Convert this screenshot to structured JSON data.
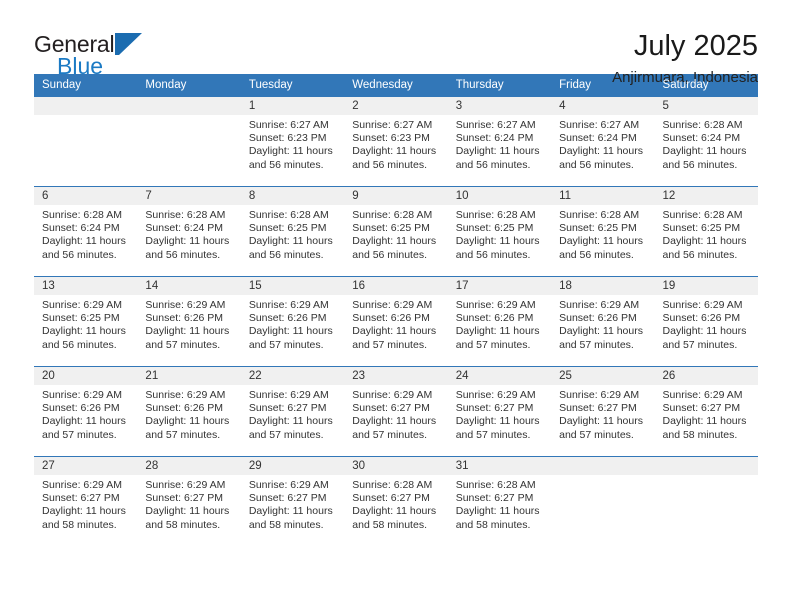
{
  "brand": {
    "name_part1": "General",
    "name_part2": "Blue",
    "mark_icon": "triangle-flag-icon",
    "accent_color": "#1b7ac4"
  },
  "header": {
    "title": "July 2025",
    "subtitle": "Anjirmuara, Indonesia",
    "header_bg_color": "#3277b8",
    "header_text_color": "#ffffff"
  },
  "weekday_headers": [
    "Sunday",
    "Monday",
    "Tuesday",
    "Wednesday",
    "Thursday",
    "Friday",
    "Saturday"
  ],
  "labels": {
    "sunrise_prefix": "Sunrise:",
    "sunset_prefix": "Sunset:",
    "daylight_prefix": "Daylight:"
  },
  "chart_data": {
    "type": "table",
    "title": "July 2025",
    "subtitle": "Anjirmuara, Indonesia",
    "columns": [
      "Sunday",
      "Monday",
      "Tuesday",
      "Wednesday",
      "Thursday",
      "Friday",
      "Saturday"
    ],
    "rows": [
      [
        null,
        null,
        {
          "day": "1",
          "sunrise": "6:27 AM",
          "sunset": "6:23 PM",
          "daylight_hours": 11,
          "daylight_minutes": 56
        },
        {
          "day": "2",
          "sunrise": "6:27 AM",
          "sunset": "6:23 PM",
          "daylight_hours": 11,
          "daylight_minutes": 56
        },
        {
          "day": "3",
          "sunrise": "6:27 AM",
          "sunset": "6:24 PM",
          "daylight_hours": 11,
          "daylight_minutes": 56
        },
        {
          "day": "4",
          "sunrise": "6:27 AM",
          "sunset": "6:24 PM",
          "daylight_hours": 11,
          "daylight_minutes": 56
        },
        {
          "day": "5",
          "sunrise": "6:28 AM",
          "sunset": "6:24 PM",
          "daylight_hours": 11,
          "daylight_minutes": 56
        }
      ],
      [
        {
          "day": "6",
          "sunrise": "6:28 AM",
          "sunset": "6:24 PM",
          "daylight_hours": 11,
          "daylight_minutes": 56
        },
        {
          "day": "7",
          "sunrise": "6:28 AM",
          "sunset": "6:24 PM",
          "daylight_hours": 11,
          "daylight_minutes": 56
        },
        {
          "day": "8",
          "sunrise": "6:28 AM",
          "sunset": "6:25 PM",
          "daylight_hours": 11,
          "daylight_minutes": 56
        },
        {
          "day": "9",
          "sunrise": "6:28 AM",
          "sunset": "6:25 PM",
          "daylight_hours": 11,
          "daylight_minutes": 56
        },
        {
          "day": "10",
          "sunrise": "6:28 AM",
          "sunset": "6:25 PM",
          "daylight_hours": 11,
          "daylight_minutes": 56
        },
        {
          "day": "11",
          "sunrise": "6:28 AM",
          "sunset": "6:25 PM",
          "daylight_hours": 11,
          "daylight_minutes": 56
        },
        {
          "day": "12",
          "sunrise": "6:28 AM",
          "sunset": "6:25 PM",
          "daylight_hours": 11,
          "daylight_minutes": 56
        }
      ],
      [
        {
          "day": "13",
          "sunrise": "6:29 AM",
          "sunset": "6:25 PM",
          "daylight_hours": 11,
          "daylight_minutes": 56
        },
        {
          "day": "14",
          "sunrise": "6:29 AM",
          "sunset": "6:26 PM",
          "daylight_hours": 11,
          "daylight_minutes": 57
        },
        {
          "day": "15",
          "sunrise": "6:29 AM",
          "sunset": "6:26 PM",
          "daylight_hours": 11,
          "daylight_minutes": 57
        },
        {
          "day": "16",
          "sunrise": "6:29 AM",
          "sunset": "6:26 PM",
          "daylight_hours": 11,
          "daylight_minutes": 57
        },
        {
          "day": "17",
          "sunrise": "6:29 AM",
          "sunset": "6:26 PM",
          "daylight_hours": 11,
          "daylight_minutes": 57
        },
        {
          "day": "18",
          "sunrise": "6:29 AM",
          "sunset": "6:26 PM",
          "daylight_hours": 11,
          "daylight_minutes": 57
        },
        {
          "day": "19",
          "sunrise": "6:29 AM",
          "sunset": "6:26 PM",
          "daylight_hours": 11,
          "daylight_minutes": 57
        }
      ],
      [
        {
          "day": "20",
          "sunrise": "6:29 AM",
          "sunset": "6:26 PM",
          "daylight_hours": 11,
          "daylight_minutes": 57
        },
        {
          "day": "21",
          "sunrise": "6:29 AM",
          "sunset": "6:26 PM",
          "daylight_hours": 11,
          "daylight_minutes": 57
        },
        {
          "day": "22",
          "sunrise": "6:29 AM",
          "sunset": "6:27 PM",
          "daylight_hours": 11,
          "daylight_minutes": 57
        },
        {
          "day": "23",
          "sunrise": "6:29 AM",
          "sunset": "6:27 PM",
          "daylight_hours": 11,
          "daylight_minutes": 57
        },
        {
          "day": "24",
          "sunrise": "6:29 AM",
          "sunset": "6:27 PM",
          "daylight_hours": 11,
          "daylight_minutes": 57
        },
        {
          "day": "25",
          "sunrise": "6:29 AM",
          "sunset": "6:27 PM",
          "daylight_hours": 11,
          "daylight_minutes": 57
        },
        {
          "day": "26",
          "sunrise": "6:29 AM",
          "sunset": "6:27 PM",
          "daylight_hours": 11,
          "daylight_minutes": 58
        }
      ],
      [
        {
          "day": "27",
          "sunrise": "6:29 AM",
          "sunset": "6:27 PM",
          "daylight_hours": 11,
          "daylight_minutes": 58
        },
        {
          "day": "28",
          "sunrise": "6:29 AM",
          "sunset": "6:27 PM",
          "daylight_hours": 11,
          "daylight_minutes": 58
        },
        {
          "day": "29",
          "sunrise": "6:29 AM",
          "sunset": "6:27 PM",
          "daylight_hours": 11,
          "daylight_minutes": 58
        },
        {
          "day": "30",
          "sunrise": "6:28 AM",
          "sunset": "6:27 PM",
          "daylight_hours": 11,
          "daylight_minutes": 58
        },
        {
          "day": "31",
          "sunrise": "6:28 AM",
          "sunset": "6:27 PM",
          "daylight_hours": 11,
          "daylight_minutes": 58
        },
        null,
        null
      ]
    ]
  }
}
